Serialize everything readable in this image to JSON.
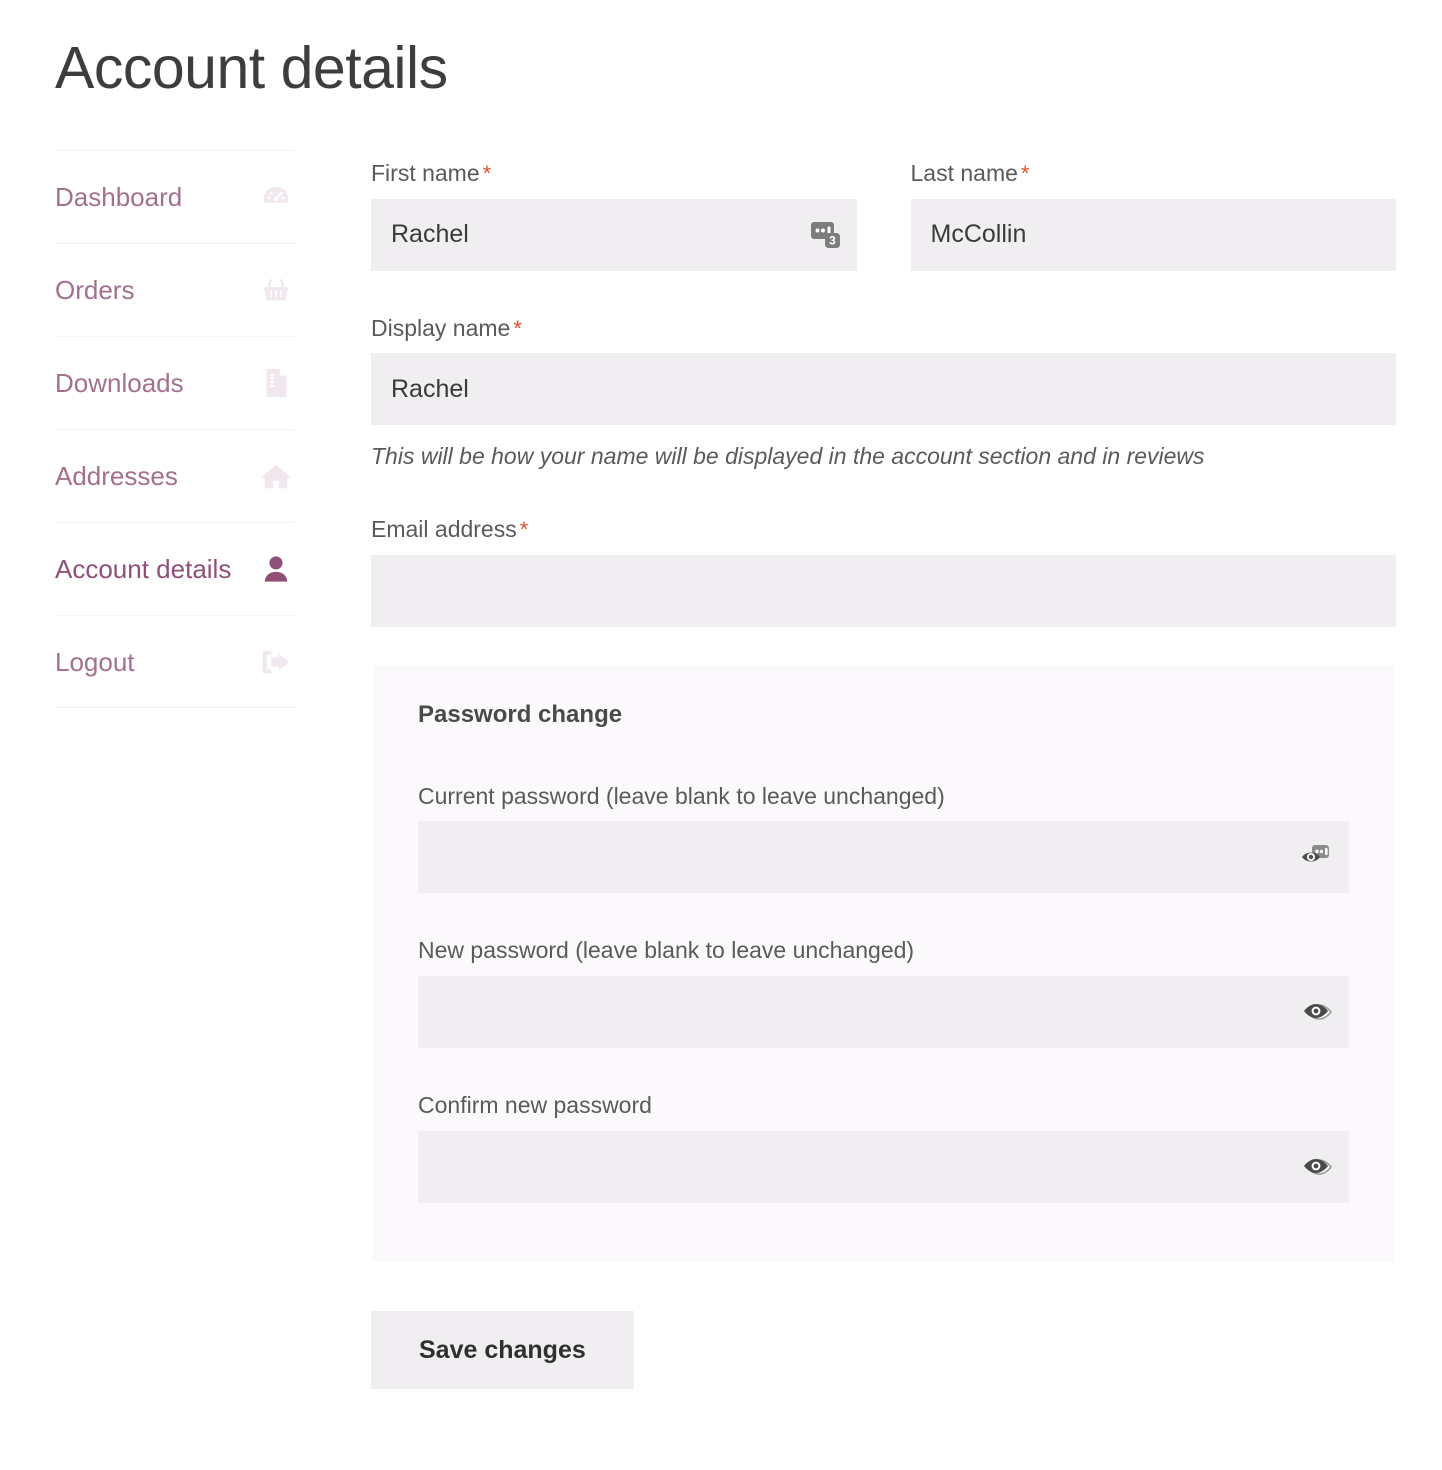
{
  "page": {
    "title": "Account details"
  },
  "sidebar": {
    "items": [
      {
        "label": "Dashboard",
        "icon": "gauge-icon",
        "active": false
      },
      {
        "label": "Orders",
        "icon": "basket-icon",
        "active": false
      },
      {
        "label": "Downloads",
        "icon": "download-file-icon",
        "active": false
      },
      {
        "label": "Addresses",
        "icon": "home-icon",
        "active": false
      },
      {
        "label": "Account details",
        "icon": "user-icon",
        "active": true
      },
      {
        "label": "Logout",
        "icon": "logout-icon",
        "active": false
      }
    ]
  },
  "form": {
    "first_name": {
      "label": "First name",
      "required_mark": "*",
      "value": "Rachel",
      "placeholder": "",
      "addon_icon": "password-manager-icon",
      "addon_badge": "3"
    },
    "last_name": {
      "label": "Last name",
      "required_mark": "*",
      "value": "McCollin",
      "placeholder": ""
    },
    "display_name": {
      "label": "Display name",
      "required_mark": "*",
      "value": "Rachel",
      "placeholder": "",
      "hint": "This will be how your name will be displayed in the account section and in reviews"
    },
    "email": {
      "label": "Email address",
      "required_mark": "*",
      "value": "",
      "placeholder": ""
    },
    "password_change": {
      "legend": "Password change",
      "current_password": {
        "label": "Current password (leave blank to leave unchanged)",
        "value": "",
        "placeholder": "",
        "addon_icon": "eye-password-manager-icon"
      },
      "new_password": {
        "label": "New password (leave blank to leave unchanged)",
        "value": "",
        "placeholder": "",
        "addon_icon": "eye-icon"
      },
      "confirm_password": {
        "label": "Confirm new password",
        "value": "",
        "placeholder": "",
        "addon_icon": "eye-icon"
      }
    },
    "save_label": "Save changes"
  },
  "colors": {
    "accent_purple": "#8f4f79",
    "nav_link": "#a4708f",
    "required_asterisk": "#e0502b",
    "input_bg": "#f0eef1",
    "fieldset_bg": "#fbf9fb"
  }
}
